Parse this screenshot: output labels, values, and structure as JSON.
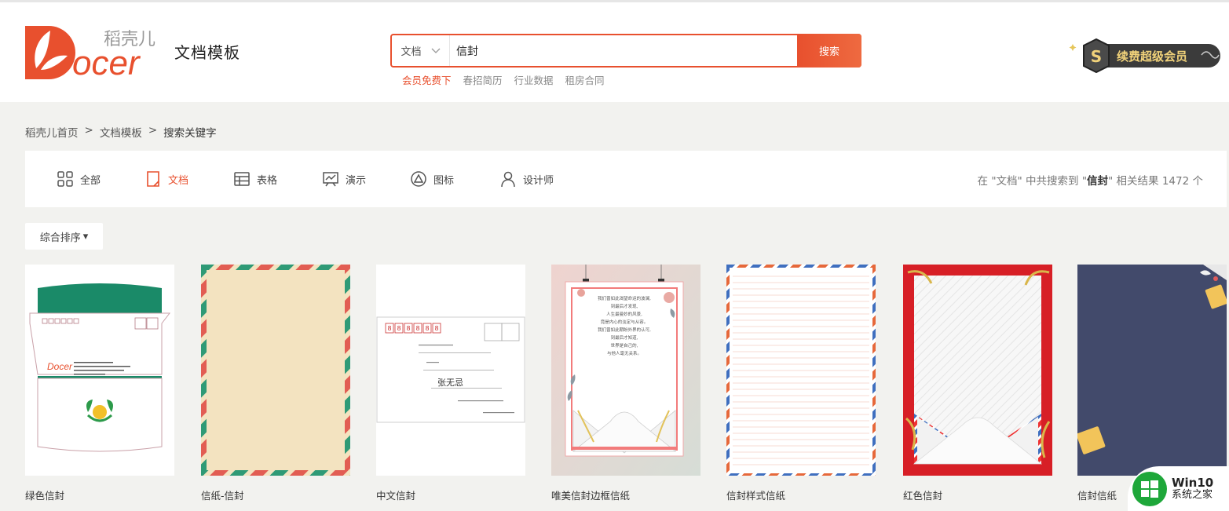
{
  "header": {
    "logo_cn": "稻壳儿",
    "logo_en": "Docer",
    "section_title": "文档模板",
    "vip_label": "续费超级会员"
  },
  "search": {
    "type_label": "文档",
    "query": "信封",
    "button_label": "搜索",
    "hot_words": [
      "会员免费下",
      "春招简历",
      "行业数据",
      "租房合同"
    ]
  },
  "breadcrumb": [
    "稻壳儿首页",
    ">",
    "文档模板",
    ">",
    "搜索关键字"
  ],
  "tabs": [
    {
      "label": "全部",
      "icon": "grid-icon"
    },
    {
      "label": "文档",
      "icon": "document-icon"
    },
    {
      "label": "表格",
      "icon": "table-icon"
    },
    {
      "label": "演示",
      "icon": "presentation-icon"
    },
    {
      "label": "图标",
      "icon": "triangle-circle-icon"
    },
    {
      "label": "设计师",
      "icon": "user-icon"
    }
  ],
  "active_tab": "文档",
  "result_summary": {
    "prefix": "在 \"文档\" 中共搜索到 \"",
    "keyword": "信封",
    "suffix": "\" 相关结果 1472 个"
  },
  "sort": {
    "label": "综合排序",
    "caret": "▾"
  },
  "cards": [
    {
      "title": "绿色信封"
    },
    {
      "title": "信纸-信封"
    },
    {
      "title": "中文信封"
    },
    {
      "title": "唯美信封边框信纸"
    },
    {
      "title": "信封样式信纸"
    },
    {
      "title": "红色信封"
    },
    {
      "title": "信封信纸"
    }
  ],
  "thumb_text": {
    "stamp_digits": [
      "8",
      "8",
      "8",
      "8",
      "8",
      "8"
    ],
    "recipient": "张无忌",
    "poem_lines": [
      "我们曾如此渴望命运的波澜,",
      "到最后才发现,",
      "人生最曼妙的风景,",
      "竟是内心的淡定与从容。",
      "我们曾如此期盼外界的认可,",
      "到最后才知道,",
      "世界是自己的,",
      "与他人毫无关系。"
    ]
  },
  "watermark": {
    "line1": "Win10",
    "line2": "系统之家"
  },
  "colors": {
    "accent": "#e8502e",
    "green": "#1a8a68",
    "background": "#f2f2ef"
  }
}
